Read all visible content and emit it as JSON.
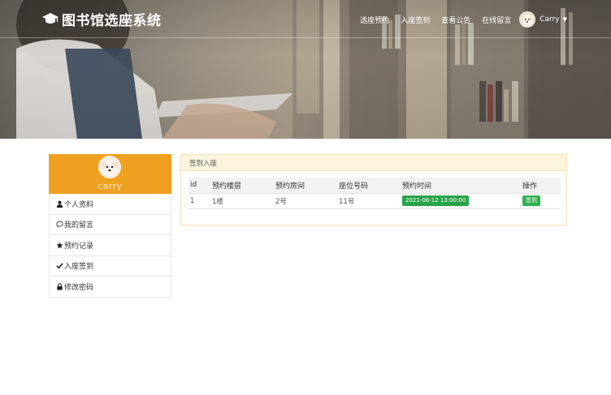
{
  "header": {
    "brand_title": "图书馆选座系统",
    "nav_items": [
      "选座预约",
      "入座签到",
      "查看公告",
      "在线留言"
    ],
    "user_name": "Carry"
  },
  "sidebar": {
    "profile_name": "carry",
    "items": [
      {
        "label": "个人资料",
        "icon": "user-icon"
      },
      {
        "label": "我的留言",
        "icon": "comment-icon"
      },
      {
        "label": "预约记录",
        "icon": "star-icon"
      },
      {
        "label": "入座签到",
        "icon": "check-icon"
      },
      {
        "label": "修改密码",
        "icon": "lock-icon"
      }
    ]
  },
  "main": {
    "panel_title": "签到入座",
    "table": {
      "headers": [
        "id",
        "预约楼层",
        "预约房间",
        "座位号码",
        "预约时间",
        "操作"
      ],
      "rows": [
        {
          "id": "1",
          "floor": "1楼",
          "room": "2号",
          "seat": "11号",
          "time": "2021-06-12 13:00:00",
          "action": "签到"
        }
      ]
    }
  },
  "colors": {
    "accent": "#f0a020",
    "success": "#29a348",
    "panel_heading_bg": "#fcf4dc"
  }
}
